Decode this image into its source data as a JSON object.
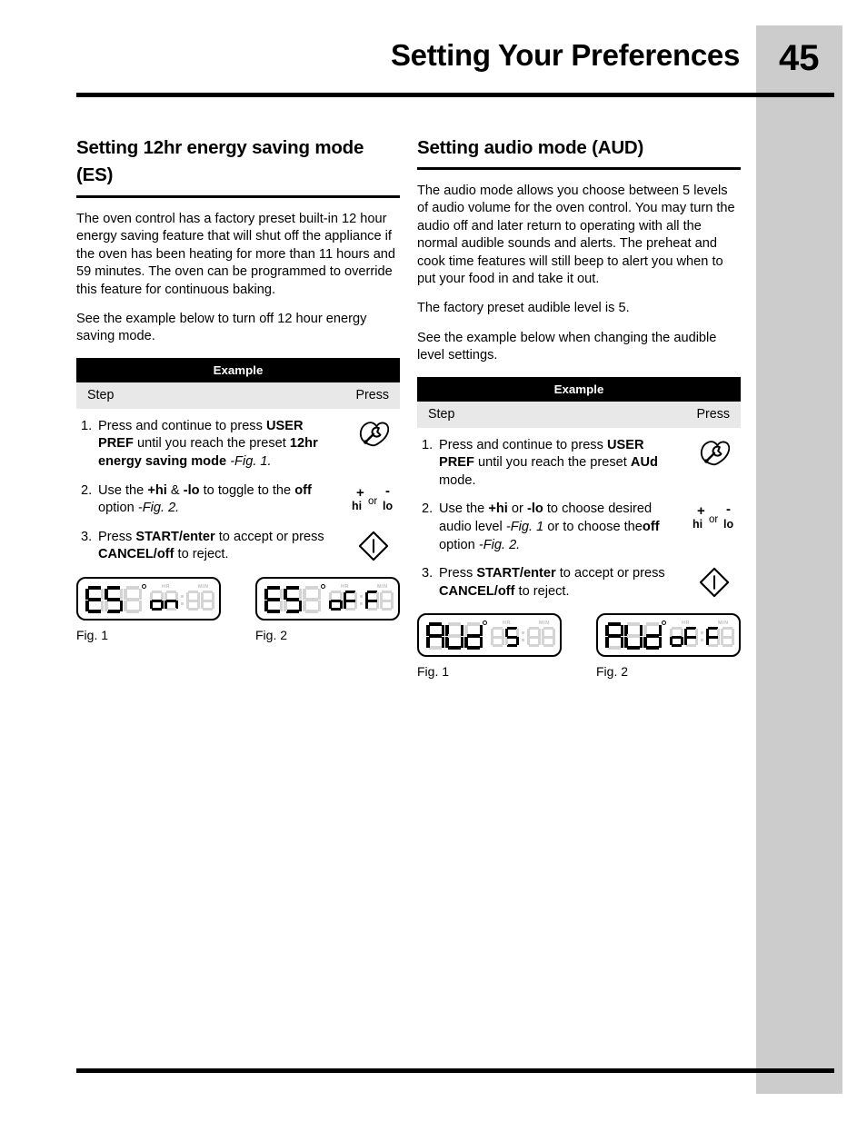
{
  "header": {
    "title": "Setting Your Preferences",
    "page_number": "45"
  },
  "left_column": {
    "section_title": "Setting 12hr energy saving mode (ES)",
    "paragraphs": [
      "The oven control has a factory preset built-in 12 hour energy saving feature that will shut off the appliance if the oven has been heating  for more than 11 hours and 59 minutes. The oven can be programmed to override this feature for continuous baking.",
      "See the example below to turn off 12 hour energy saving mode."
    ],
    "table": {
      "title": "Example",
      "col_step": "Step",
      "col_press": "Press",
      "rows": [
        {
          "num": "1.",
          "text_html": "Press and continue to press <b>USER PREF </b>until you reach the preset <b>12hr energy saving mode </b><i>-Fig. 1.</i>",
          "icon": "user-pref-wrench-icon"
        },
        {
          "num": "2.",
          "text_html": "Use the <b>+hi</b> &amp; <b>-lo</b> to toggle to the <b>off</b> option  <i>-Fig. 2.</i>",
          "icon": "hi-lo-icon"
        },
        {
          "num": "3.",
          "text_html": "Press <b>START/enter</b> to accept or press <b>CANCEL/off</b> to reject.",
          "icon": "start-enter-diamond-icon"
        }
      ]
    },
    "figures": [
      {
        "caption": "Fig. 1",
        "lcd_mode": "ES",
        "lcd_value": "on"
      },
      {
        "caption": "Fig. 2",
        "lcd_mode": "ES",
        "lcd_value": "oFF"
      }
    ]
  },
  "right_column": {
    "section_title": "Setting audio mode (AUD)",
    "paragraphs": [
      "The audio mode allows you choose between 5 levels of audio volume for the oven control. You may turn the audio off and later return to operating with all the normal audible sounds and alerts. The preheat and cook time features will still beep to alert you when to put your food in and take it out.",
      "The factory preset audible level is 5.",
      "See the example below when changing the audible level settings."
    ],
    "table": {
      "title": "Example",
      "col_step": "Step",
      "col_press": "Press",
      "rows": [
        {
          "num": "1.",
          "text_html": "Press and continue to press <b>USER PREF </b>until you reach the preset <b>AUd </b>mode.",
          "icon": "user-pref-wrench-icon"
        },
        {
          "num": "2.",
          "text_html": "Use the <b>+hi</b> or <b>-lo</b> to choose desired audio level <i>-Fig. 1</i> or to choose the<b>off</b> option <i>-Fig. 2.</i>",
          "icon": "hi-lo-icon"
        },
        {
          "num": "3.",
          "text_html": "Press <b>START/enter</b> to accept or press <b>CANCEL/off</b> to reject.",
          "icon": "start-enter-diamond-icon"
        }
      ]
    },
    "figures": [
      {
        "caption": "Fig. 1",
        "lcd_mode": "AUd",
        "lcd_value": "5"
      },
      {
        "caption": "Fig. 2",
        "lcd_mode": "AUd",
        "lcd_value": "oFF"
      }
    ]
  },
  "lcd_labels": {
    "hr": "HR",
    "min": "MIN"
  },
  "icons": {
    "hi_lo": {
      "plus": "+",
      "minus": "-",
      "hi": "hi",
      "lo": "lo",
      "or": "or"
    }
  },
  "colors": {
    "sidebar_gray": "#cccccc",
    "table_header_bg": "#000000",
    "table_subhead_bg": "#e8e8e8",
    "lcd_off_segment": "#d4d4d4",
    "lcd_on_segment": "#000000"
  }
}
